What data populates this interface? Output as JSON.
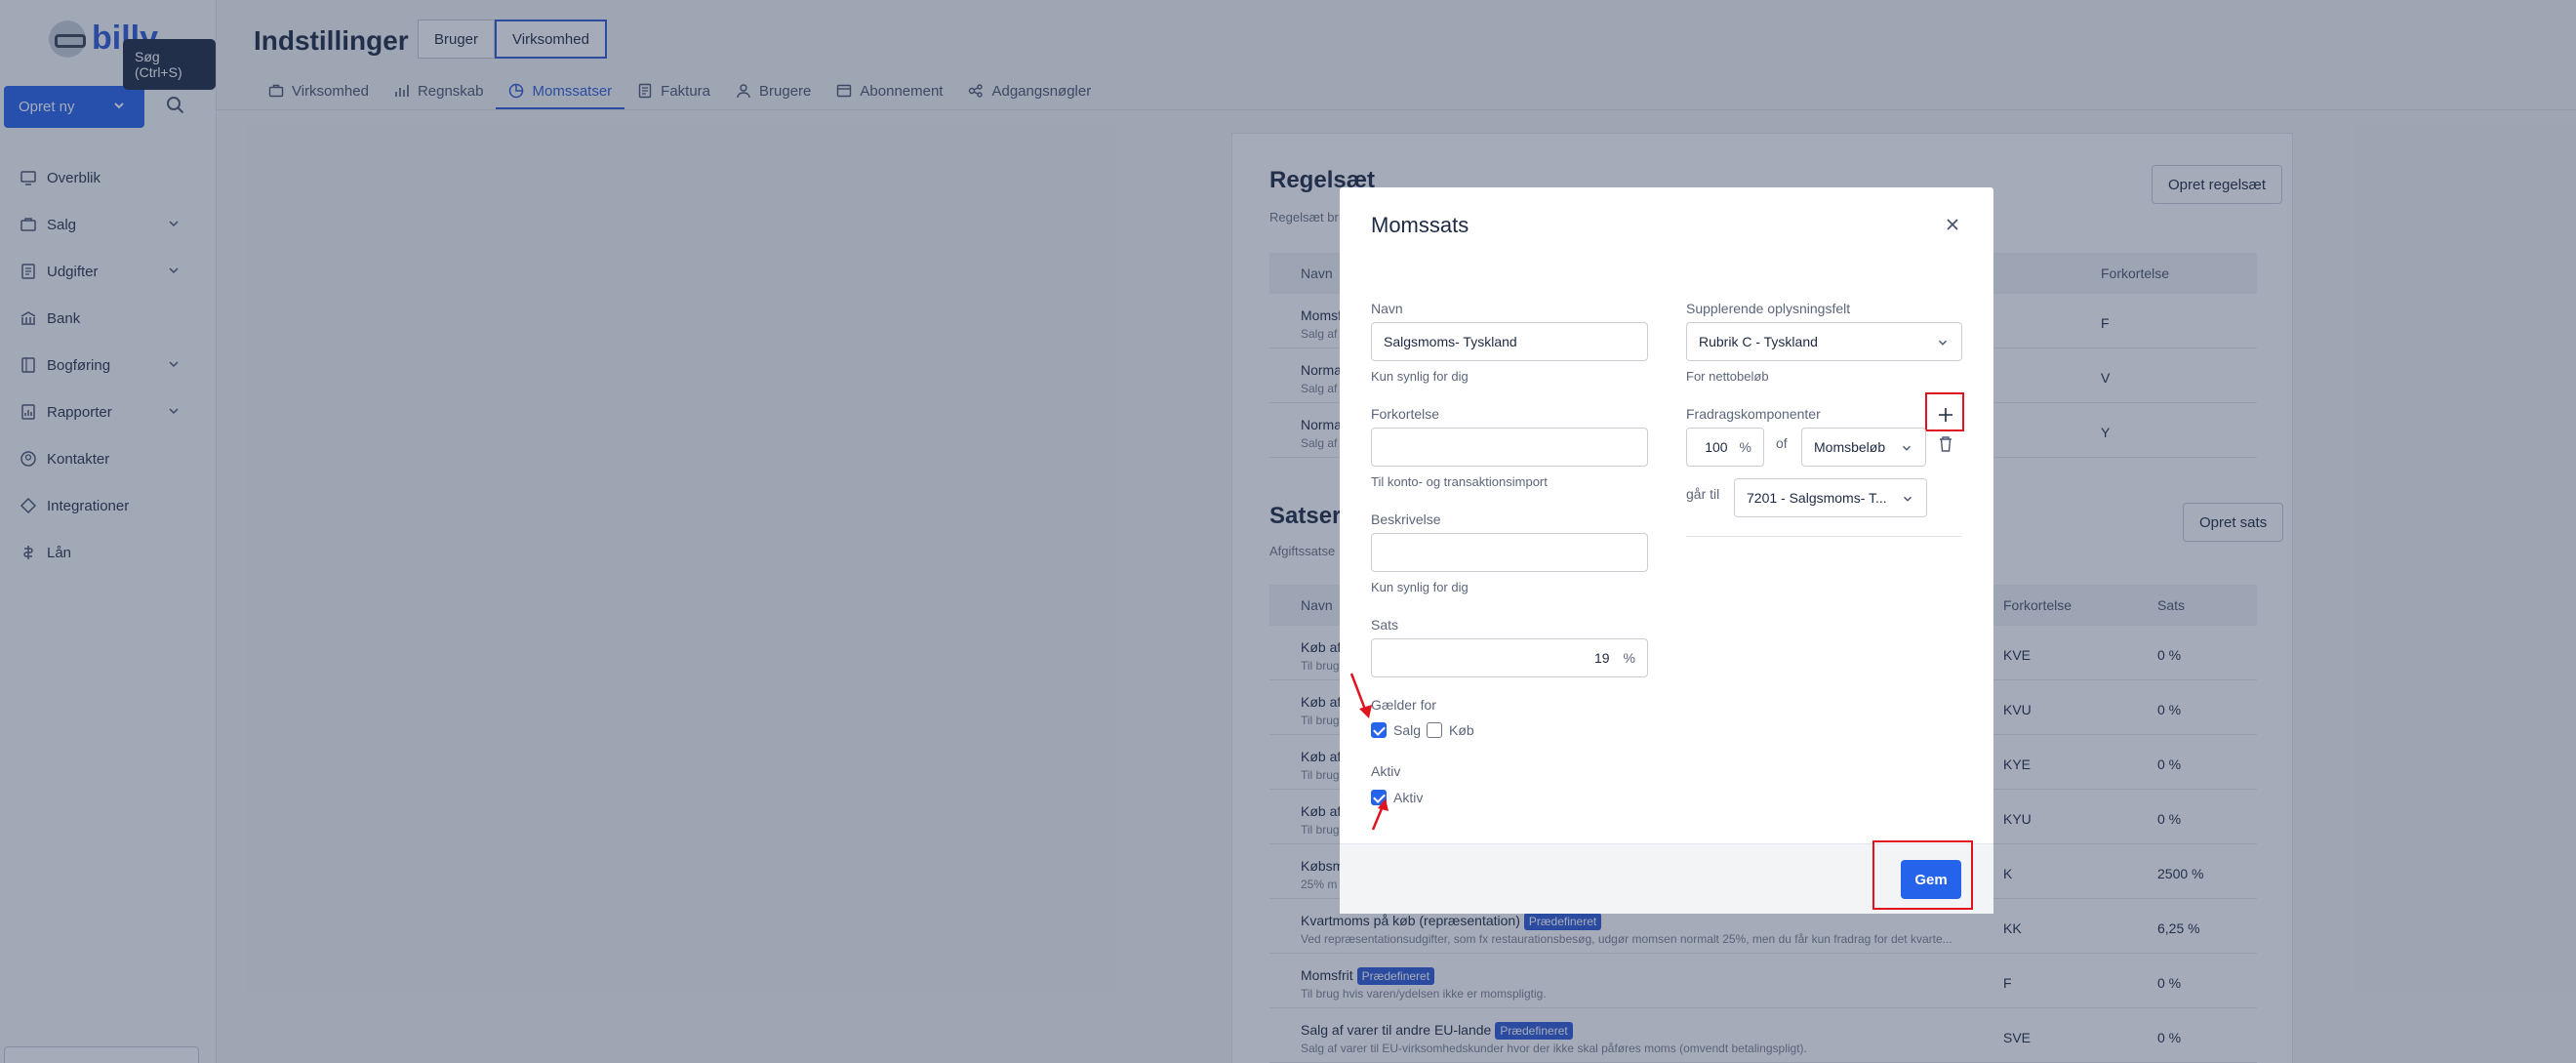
{
  "app": {
    "logo_text": "billy",
    "tooltip": "Søg (Ctrl+S)",
    "create_label": "Opret ny"
  },
  "sidebar": {
    "items": [
      {
        "label": "Overblik",
        "icon": "dashboard-icon",
        "has_chevron": false
      },
      {
        "label": "Salg",
        "icon": "sales-icon",
        "has_chevron": true
      },
      {
        "label": "Udgifter",
        "icon": "expenses-icon",
        "has_chevron": true
      },
      {
        "label": "Bank",
        "icon": "bank-icon",
        "has_chevron": false
      },
      {
        "label": "Bogføring",
        "icon": "ledger-icon",
        "has_chevron": true
      },
      {
        "label": "Rapporter",
        "icon": "reports-icon",
        "has_chevron": true
      },
      {
        "label": "Kontakter",
        "icon": "contacts-icon",
        "has_chevron": false
      },
      {
        "label": "Integrationer",
        "icon": "integrations-icon",
        "has_chevron": false
      },
      {
        "label": "Lån",
        "icon": "loan-icon",
        "has_chevron": false
      }
    ]
  },
  "header": {
    "title": "Indstillinger",
    "segments": [
      "Bruger",
      "Virksomhed"
    ],
    "tabs": [
      "Virksomhed",
      "Regnskab",
      "Momssatser",
      "Faktura",
      "Brugere",
      "Abonnement",
      "Adgangsnøgler"
    ]
  },
  "background": {
    "ruleset_title": "Regelsæt",
    "ruleset_sub": "Regelsæt br",
    "create_ruleset": "Opret regelsæt",
    "ruleset_headers": [
      "Navn",
      "Forkortelse"
    ],
    "ruleset_rows": [
      {
        "name": "Momsf",
        "desc": "Salg af",
        "abbr": "F"
      },
      {
        "name": "Norma",
        "desc": "Salg af",
        "abbr": "V"
      },
      {
        "name": "Norma",
        "desc": "Salg af",
        "abbr": "Y"
      }
    ],
    "rates_title": "Satser",
    "rates_sub": "Afgiftssatse",
    "create_rate": "Opret sats",
    "rates_headers": [
      "Navn",
      "Forkortelse",
      "Sats"
    ],
    "rates_rows": [
      {
        "name": "Køb af",
        "badge": "",
        "desc": "Til brug",
        "abbr": "KVE",
        "rate": "0 %"
      },
      {
        "name": "Køb af",
        "badge": "",
        "desc": "Til brug",
        "abbr": "KVU",
        "rate": "0 %"
      },
      {
        "name": "Køb af",
        "badge": "",
        "desc": "Til brug",
        "abbr": "KYE",
        "rate": "0 %"
      },
      {
        "name": "Køb af",
        "badge": "",
        "desc": "Til brug",
        "abbr": "KYU",
        "rate": "0 %"
      },
      {
        "name": "Købsm",
        "badge": "",
        "desc": "25% m",
        "abbr": "K",
        "rate": "2500 %"
      },
      {
        "name": "Kvartmoms på køb (repræsentation)",
        "badge": "Prædefineret",
        "desc": "Ved repræsentationsudgifter, som fx restaurationsbesøg, udgør momsen normalt 25%, men du får kun fradrag for det kvarte...",
        "abbr": "KK",
        "rate": "6,25 %"
      },
      {
        "name": "Momsfrit",
        "badge": "Prædefineret",
        "desc": "Til brug hvis varen/ydelsen ikke er momspligtig.",
        "abbr": "F",
        "rate": "0 %"
      },
      {
        "name": "Salg af varer til andre EU-lande",
        "badge": "Prædefineret",
        "desc": "Salg af varer til EU-virksomhedskunder hvor der ikke skal påføres moms (omvendt betalingspligt).",
        "abbr": "SVE",
        "rate": "0 %"
      }
    ]
  },
  "modal": {
    "title": "Momssats",
    "name_label": "Navn",
    "name_value": "Salgsmoms- Tyskland",
    "name_hint": "Kun synlig for dig",
    "abbr_label": "Forkortelse",
    "abbr_value": "",
    "abbr_hint": "Til konto- og transaktionsimport",
    "desc_label": "Beskrivelse",
    "desc_value": "",
    "desc_hint": "Kun synlig for dig",
    "rate_label": "Sats",
    "rate_value": "19",
    "rate_unit": "%",
    "applies_label": "Gælder for",
    "applies_sales": "Salg",
    "applies_sales_checked": true,
    "applies_purchase": "Køb",
    "applies_purchase_checked": false,
    "active_label": "Aktiv",
    "active_checkbox": "Aktiv",
    "active_checked": true,
    "supp_label": "Supplerende oplysningsfelt",
    "supp_value": "Rubrik C - Tyskland",
    "supp_hint": "For nettobeløb",
    "deduct_label": "Fradragskomponenter",
    "deduct_percent": "100",
    "deduct_percent_unit": "%",
    "deduct_of": "of",
    "deduct_base": "Momsbeløb",
    "goes_to_label": "går til",
    "goes_to_value": "7201 - Salgsmoms- T...",
    "save_label": "Gem"
  },
  "colors": {
    "accent": "#2563eb",
    "annotation": "#e0141e"
  }
}
